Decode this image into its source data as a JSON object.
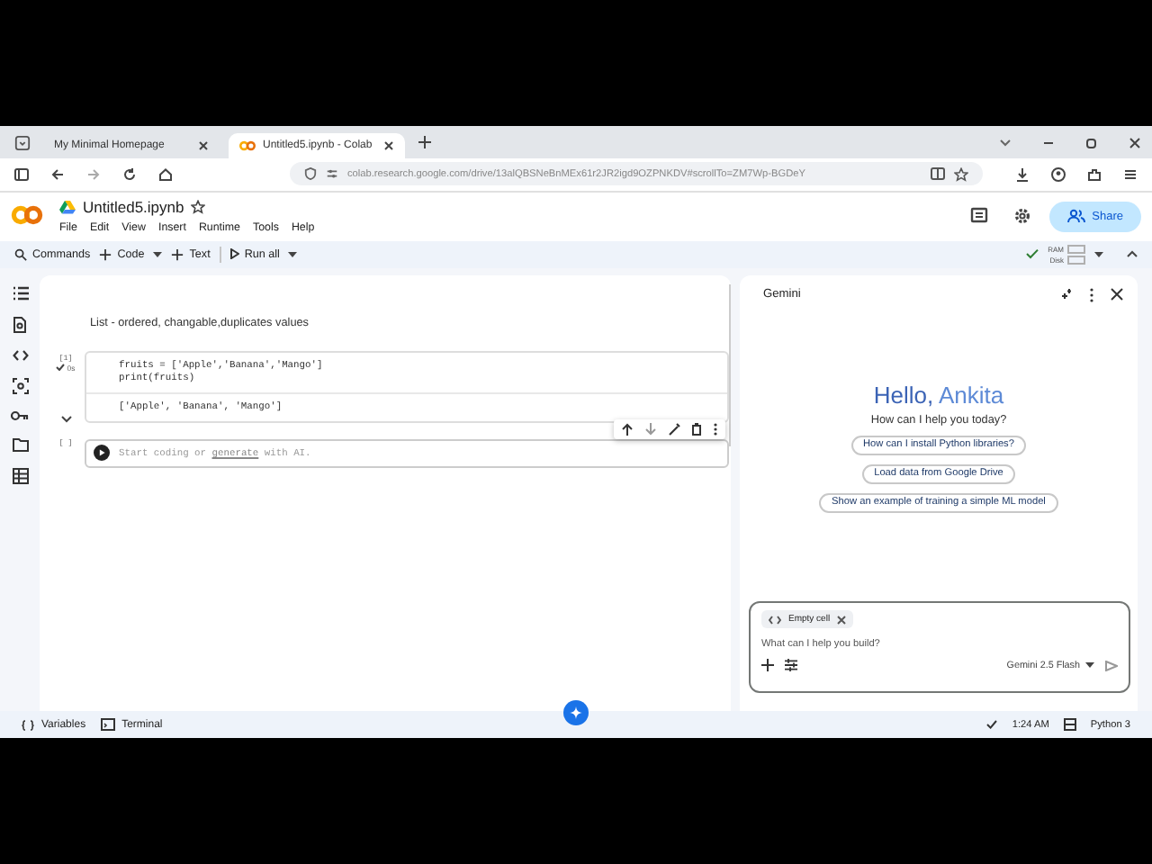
{
  "browser": {
    "tabs": [
      {
        "title": "My Minimal Homepage",
        "selected": false
      },
      {
        "title": "Untitled5.ipynb - Colab",
        "selected": true
      }
    ],
    "url": "colab.research.google.com/drive/13alQBSNeBnMEx61r2JR2igd9OZPNKDV#scrollTo=ZM7Wp-BGDeY"
  },
  "notebook": {
    "title": "Untitled5.ipynb",
    "menu": [
      "File",
      "Edit",
      "View",
      "Insert",
      "Runtime",
      "Tools",
      "Help"
    ],
    "share": "Share"
  },
  "toolbar": {
    "commands": "Commands",
    "add_code": "Code",
    "add_text": "Text",
    "run_all": "Run all",
    "ram": "RAM",
    "disk": "Disk"
  },
  "cells": [
    {
      "kind": "text",
      "text": "List - ordered, changable,duplicates values"
    },
    {
      "kind": "code",
      "count": "[1]",
      "duration": "0s",
      "lines": [
        "fruits = ['Apple','Banana','Mango']",
        "print(fruits)"
      ],
      "output": "['Apple', 'Banana', 'Mango']"
    },
    {
      "kind": "empty",
      "count": "[ ]",
      "placeholder_before": "Start coding or",
      "link": "generate",
      "placeholder_after": "with AI."
    }
  ],
  "gemini": {
    "title": "Gemini",
    "greeting_start": "Hello,",
    "greeting_name": "Ankita",
    "subtitle": "How can I help you today?",
    "suggestions": [
      "How can I install Python libraries?",
      "Load data from Google Drive",
      "Show an example of training a simple ML model"
    ],
    "chip": "Empty cell",
    "placeholder": "What can I help you build?",
    "model": "Gemini 2.5 Flash"
  },
  "status_bar": {
    "variables": "Variables",
    "terminal": "Terminal",
    "time": "1:24 AM",
    "runtime": "Python 3"
  }
}
